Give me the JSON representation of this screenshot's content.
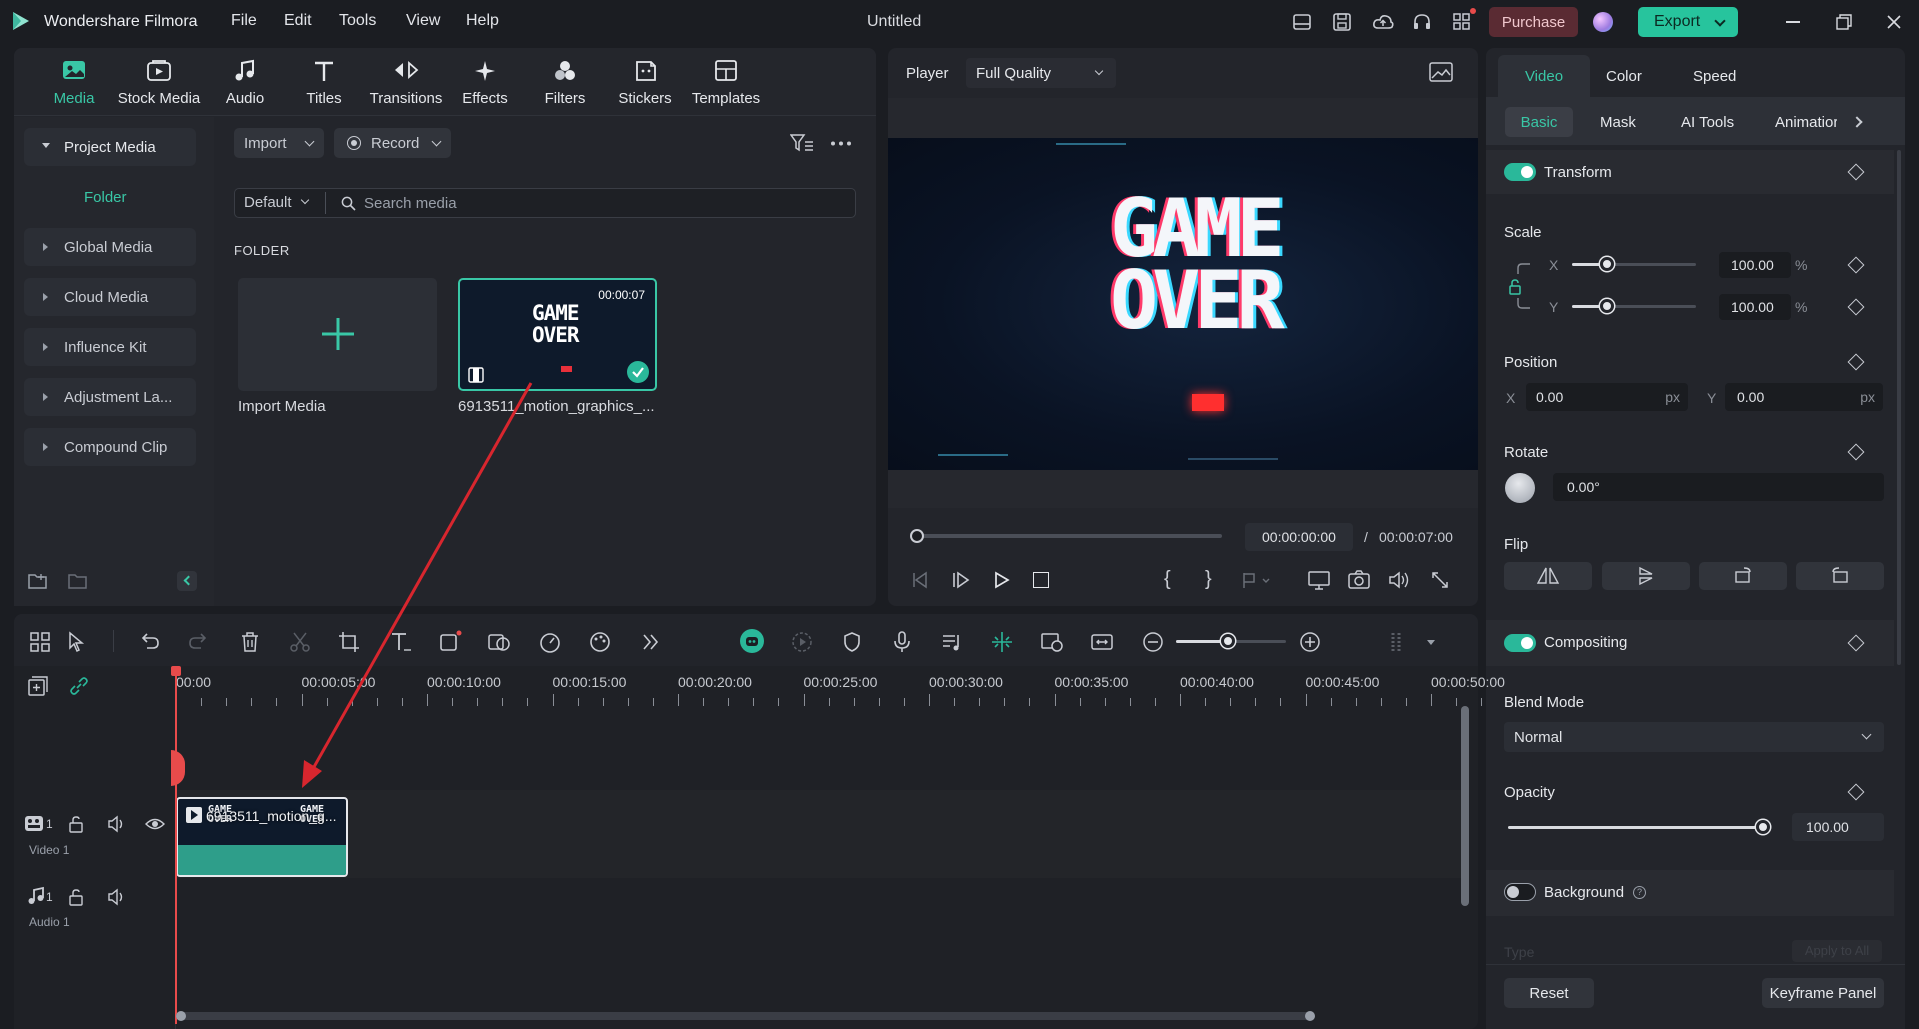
{
  "app": {
    "name": "Wondershare Filmora",
    "doc_title": "Untitled"
  },
  "menu": [
    "File",
    "Edit",
    "Tools",
    "View",
    "Help"
  ],
  "titlebar": {
    "purchase": "Purchase",
    "export": "Export"
  },
  "toolbar_tabs": [
    "Media",
    "Stock Media",
    "Audio",
    "Titles",
    "Transitions",
    "Effects",
    "Filters",
    "Stickers",
    "Templates"
  ],
  "sidebar": {
    "project_media": "Project Media",
    "folder": "Folder",
    "items": [
      "Global Media",
      "Cloud Media",
      "Influence Kit",
      "Adjustment La...",
      "Compound Clip"
    ]
  },
  "media": {
    "import": "Import",
    "record": "Record",
    "sort": "Default",
    "search_placeholder": "Search media",
    "folder_heading": "FOLDER",
    "import_media": "Import Media",
    "clip_name": "6913511_motion_graphics_...",
    "clip_duration": "00:00:07",
    "clip_text_line1": "GAME",
    "clip_text_line2": "OVER"
  },
  "player": {
    "label": "Player",
    "quality": "Full Quality",
    "time_current": "00:00:00:00",
    "time_separator": "/",
    "time_total": "00:00:07:00",
    "bracket_in": "{",
    "bracket_out": "}",
    "preview_line1": "GAME",
    "preview_line2": "OVER",
    "progress": 0
  },
  "timeline": {
    "ruler": [
      "00:00",
      "00:00:05:00",
      "00:00:10:00",
      "00:00:15:00",
      "00:00:20:00",
      "00:00:25:00",
      "00:00:30:00",
      "00:00:35:00",
      "00:00:40:00",
      "00:00:45:00",
      "00:00:50:00"
    ],
    "video_track": "Video 1",
    "audio_track": "Audio 1",
    "track_index": "1",
    "clip_label": "6913511_motion_g...",
    "clip_thumb_line1": "GAME",
    "clip_thumb_line2": "OVER"
  },
  "inspector": {
    "tabs": [
      "Video",
      "Color",
      "Speed"
    ],
    "subtabs": [
      "Basic",
      "Mask",
      "AI Tools",
      "Animatior"
    ],
    "transform": "Transform",
    "scale": "Scale",
    "scale_x_label": "X",
    "scale_y_label": "Y",
    "scale_x": "100.00",
    "scale_y": "100.00",
    "percent": "%",
    "position": "Position",
    "pos_x_label": "X",
    "pos_y_label": "Y",
    "pos_x": "0.00",
    "pos_y": "0.00",
    "px": "px",
    "rotate": "Rotate",
    "rotate_value": "0.00°",
    "flip": "Flip",
    "compositing": "Compositing",
    "blend_mode": "Blend Mode",
    "blend_value": "Normal",
    "opacity": "Opacity",
    "opacity_value": "100.00",
    "background": "Background",
    "type_faded": "Type",
    "apply_all_faded": "Apply to All",
    "reset": "Reset",
    "keyframe_panel": "Keyframe Panel"
  },
  "colors": {
    "accent": "#2ab89a",
    "export_btn": "#27c49d",
    "purchase_btn": "#5a2b33",
    "playhead": "#e84b4b",
    "annotation_arrow": "#d8262e"
  }
}
